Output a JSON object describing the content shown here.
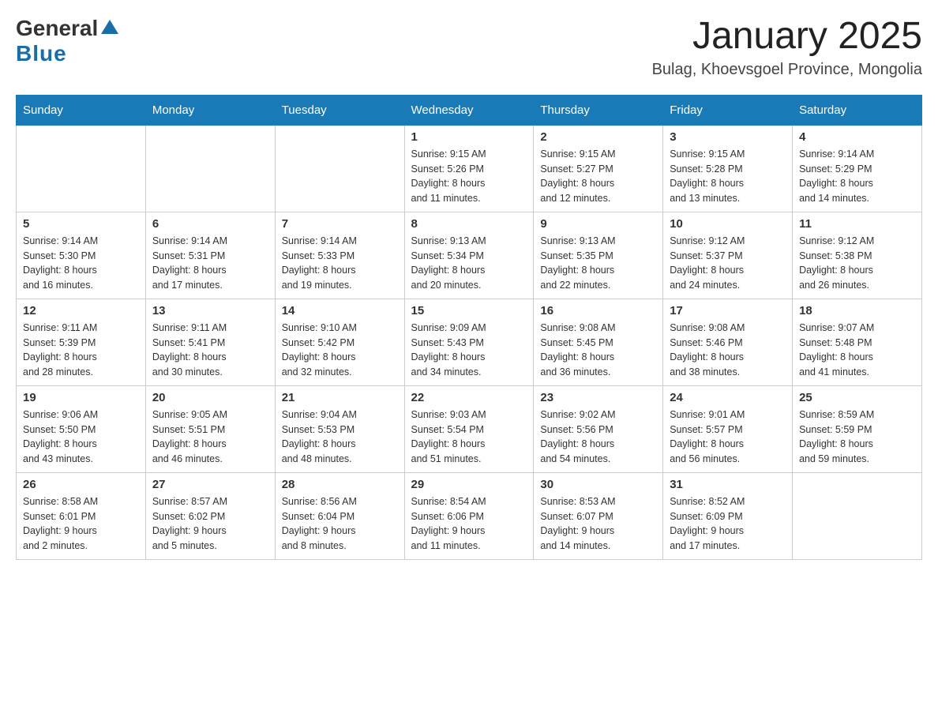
{
  "header": {
    "logo": {
      "general": "General",
      "blue": "Blue"
    },
    "title": "January 2025",
    "subtitle": "Bulag, Khoevsgoel Province, Mongolia"
  },
  "calendar": {
    "days_of_week": [
      "Sunday",
      "Monday",
      "Tuesday",
      "Wednesday",
      "Thursday",
      "Friday",
      "Saturday"
    ],
    "weeks": [
      [
        {
          "day": "",
          "info": ""
        },
        {
          "day": "",
          "info": ""
        },
        {
          "day": "",
          "info": ""
        },
        {
          "day": "1",
          "info": "Sunrise: 9:15 AM\nSunset: 5:26 PM\nDaylight: 8 hours\nand 11 minutes."
        },
        {
          "day": "2",
          "info": "Sunrise: 9:15 AM\nSunset: 5:27 PM\nDaylight: 8 hours\nand 12 minutes."
        },
        {
          "day": "3",
          "info": "Sunrise: 9:15 AM\nSunset: 5:28 PM\nDaylight: 8 hours\nand 13 minutes."
        },
        {
          "day": "4",
          "info": "Sunrise: 9:14 AM\nSunset: 5:29 PM\nDaylight: 8 hours\nand 14 minutes."
        }
      ],
      [
        {
          "day": "5",
          "info": "Sunrise: 9:14 AM\nSunset: 5:30 PM\nDaylight: 8 hours\nand 16 minutes."
        },
        {
          "day": "6",
          "info": "Sunrise: 9:14 AM\nSunset: 5:31 PM\nDaylight: 8 hours\nand 17 minutes."
        },
        {
          "day": "7",
          "info": "Sunrise: 9:14 AM\nSunset: 5:33 PM\nDaylight: 8 hours\nand 19 minutes."
        },
        {
          "day": "8",
          "info": "Sunrise: 9:13 AM\nSunset: 5:34 PM\nDaylight: 8 hours\nand 20 minutes."
        },
        {
          "day": "9",
          "info": "Sunrise: 9:13 AM\nSunset: 5:35 PM\nDaylight: 8 hours\nand 22 minutes."
        },
        {
          "day": "10",
          "info": "Sunrise: 9:12 AM\nSunset: 5:37 PM\nDaylight: 8 hours\nand 24 minutes."
        },
        {
          "day": "11",
          "info": "Sunrise: 9:12 AM\nSunset: 5:38 PM\nDaylight: 8 hours\nand 26 minutes."
        }
      ],
      [
        {
          "day": "12",
          "info": "Sunrise: 9:11 AM\nSunset: 5:39 PM\nDaylight: 8 hours\nand 28 minutes."
        },
        {
          "day": "13",
          "info": "Sunrise: 9:11 AM\nSunset: 5:41 PM\nDaylight: 8 hours\nand 30 minutes."
        },
        {
          "day": "14",
          "info": "Sunrise: 9:10 AM\nSunset: 5:42 PM\nDaylight: 8 hours\nand 32 minutes."
        },
        {
          "day": "15",
          "info": "Sunrise: 9:09 AM\nSunset: 5:43 PM\nDaylight: 8 hours\nand 34 minutes."
        },
        {
          "day": "16",
          "info": "Sunrise: 9:08 AM\nSunset: 5:45 PM\nDaylight: 8 hours\nand 36 minutes."
        },
        {
          "day": "17",
          "info": "Sunrise: 9:08 AM\nSunset: 5:46 PM\nDaylight: 8 hours\nand 38 minutes."
        },
        {
          "day": "18",
          "info": "Sunrise: 9:07 AM\nSunset: 5:48 PM\nDaylight: 8 hours\nand 41 minutes."
        }
      ],
      [
        {
          "day": "19",
          "info": "Sunrise: 9:06 AM\nSunset: 5:50 PM\nDaylight: 8 hours\nand 43 minutes."
        },
        {
          "day": "20",
          "info": "Sunrise: 9:05 AM\nSunset: 5:51 PM\nDaylight: 8 hours\nand 46 minutes."
        },
        {
          "day": "21",
          "info": "Sunrise: 9:04 AM\nSunset: 5:53 PM\nDaylight: 8 hours\nand 48 minutes."
        },
        {
          "day": "22",
          "info": "Sunrise: 9:03 AM\nSunset: 5:54 PM\nDaylight: 8 hours\nand 51 minutes."
        },
        {
          "day": "23",
          "info": "Sunrise: 9:02 AM\nSunset: 5:56 PM\nDaylight: 8 hours\nand 54 minutes."
        },
        {
          "day": "24",
          "info": "Sunrise: 9:01 AM\nSunset: 5:57 PM\nDaylight: 8 hours\nand 56 minutes."
        },
        {
          "day": "25",
          "info": "Sunrise: 8:59 AM\nSunset: 5:59 PM\nDaylight: 8 hours\nand 59 minutes."
        }
      ],
      [
        {
          "day": "26",
          "info": "Sunrise: 8:58 AM\nSunset: 6:01 PM\nDaylight: 9 hours\nand 2 minutes."
        },
        {
          "day": "27",
          "info": "Sunrise: 8:57 AM\nSunset: 6:02 PM\nDaylight: 9 hours\nand 5 minutes."
        },
        {
          "day": "28",
          "info": "Sunrise: 8:56 AM\nSunset: 6:04 PM\nDaylight: 9 hours\nand 8 minutes."
        },
        {
          "day": "29",
          "info": "Sunrise: 8:54 AM\nSunset: 6:06 PM\nDaylight: 9 hours\nand 11 minutes."
        },
        {
          "day": "30",
          "info": "Sunrise: 8:53 AM\nSunset: 6:07 PM\nDaylight: 9 hours\nand 14 minutes."
        },
        {
          "day": "31",
          "info": "Sunrise: 8:52 AM\nSunset: 6:09 PM\nDaylight: 9 hours\nand 17 minutes."
        },
        {
          "day": "",
          "info": ""
        }
      ]
    ]
  }
}
